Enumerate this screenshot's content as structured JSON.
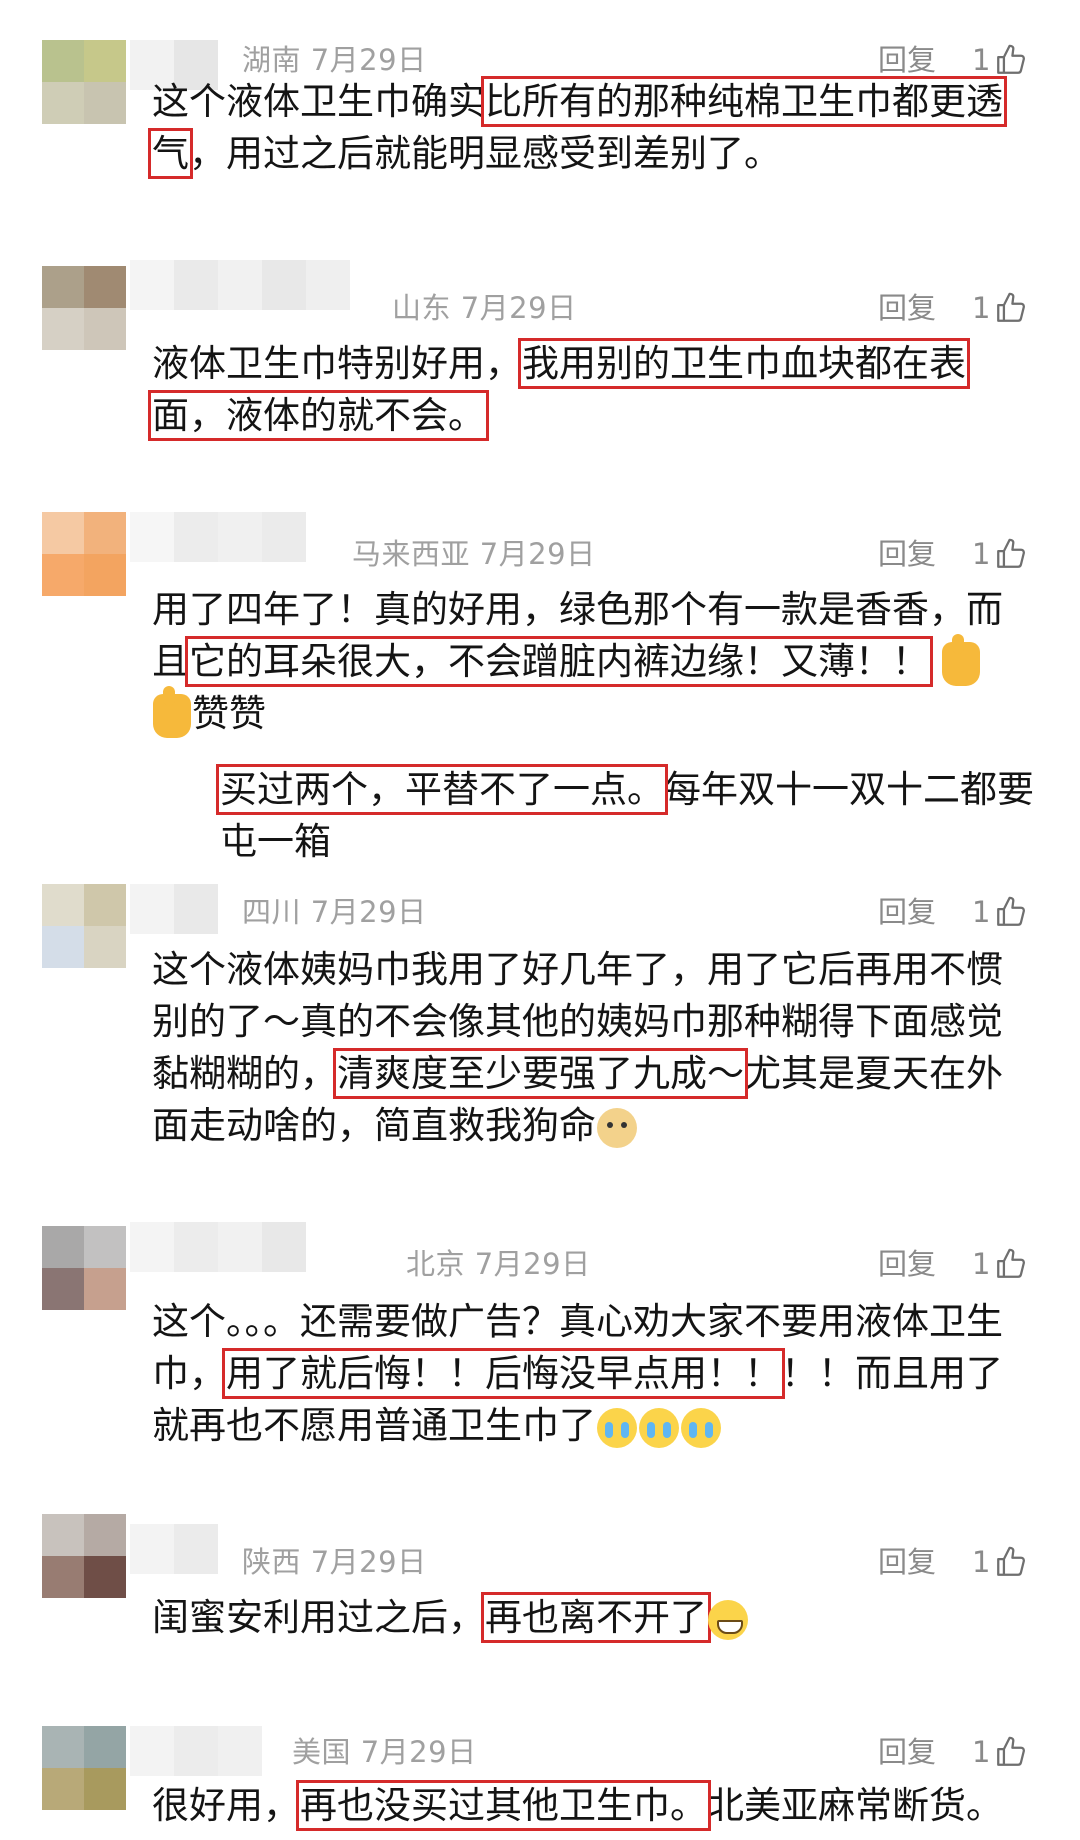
{
  "reply_label": "回复",
  "colors": {
    "highlight_box": "#d52a2a",
    "meta_text": "#a0a0a0"
  },
  "comments": [
    {
      "location": "湖南",
      "date": "7月29日",
      "likes": "1",
      "parts": [
        {
          "t": "这个液体卫生巾确实",
          "hl": false
        },
        {
          "t": "比所有的那种纯棉卫生巾都更透气",
          "hl": true
        },
        {
          "t": "，用过之后就能明显感受到差别了。",
          "hl": false
        }
      ]
    },
    {
      "location": "山东",
      "date": "7月29日",
      "likes": "1",
      "parts": [
        {
          "t": "液体卫生巾特别好用，",
          "hl": false
        },
        {
          "t": "我用别的卫生巾血块都在表面，液体的就不会。",
          "hl": true
        }
      ]
    },
    {
      "location": "马来西亚",
      "date": "7月29日",
      "likes": "1",
      "parts": [
        {
          "t": "用了四年了！真的好用，绿色那个有一款是香香，而且",
          "hl": false
        },
        {
          "t": "它的耳朵很大，不会蹭脏内裤边缘！又薄！！",
          "hl": true
        }
      ],
      "emoji_tail": [
        "thumbs-up",
        "thumbs-up"
      ],
      "tail_text": "赞赞",
      "sub_parts": [
        {
          "t": "买过两个，平替不了一点。",
          "hl": true
        },
        {
          "t": "每年双十一双十二都要屯一箱",
          "hl": false
        }
      ]
    },
    {
      "location": "四川",
      "date": "7月29日",
      "likes": "1",
      "parts": [
        {
          "t": "这个液体姨妈巾我用了好几年了，用了它后再用不惯别的了～真的不会像其他的姨妈巾那种糊得下面感觉黏糊糊的，",
          "hl": false
        },
        {
          "t": "清爽度至少要强了九成～",
          "hl": true
        },
        {
          "t": "尤其是夏天在外面走动啥的，简直救我狗命",
          "hl": false
        }
      ],
      "emoji_tail": [
        "doge"
      ]
    },
    {
      "location": "北京",
      "date": "7月29日",
      "likes": "1",
      "parts": [
        {
          "t": "这个。。。还需要做广告？真心劝大家不要用液体卫生巾，",
          "hl": false
        },
        {
          "t": "用了就后悔！！后悔没早点用！！",
          "hl": true
        },
        {
          "t": "！！而且用了就再也不愿用普通卫生巾了",
          "hl": false
        }
      ],
      "emoji_tail": [
        "crying",
        "crying",
        "crying"
      ]
    },
    {
      "location": "陕西",
      "date": "7月29日",
      "likes": "1",
      "parts": [
        {
          "t": "闺蜜安利用过之后，",
          "hl": false
        },
        {
          "t": "再也离不开了",
          "hl": true
        }
      ],
      "emoji_tail": [
        "grin"
      ]
    },
    {
      "location": "美国",
      "date": "7月29日",
      "likes": "1",
      "parts": [
        {
          "t": "很好用，",
          "hl": false
        },
        {
          "t": "再也没买过其他卫生巾。",
          "hl": true
        },
        {
          "t": "北美亚麻常断货。",
          "hl": false
        }
      ]
    }
  ]
}
